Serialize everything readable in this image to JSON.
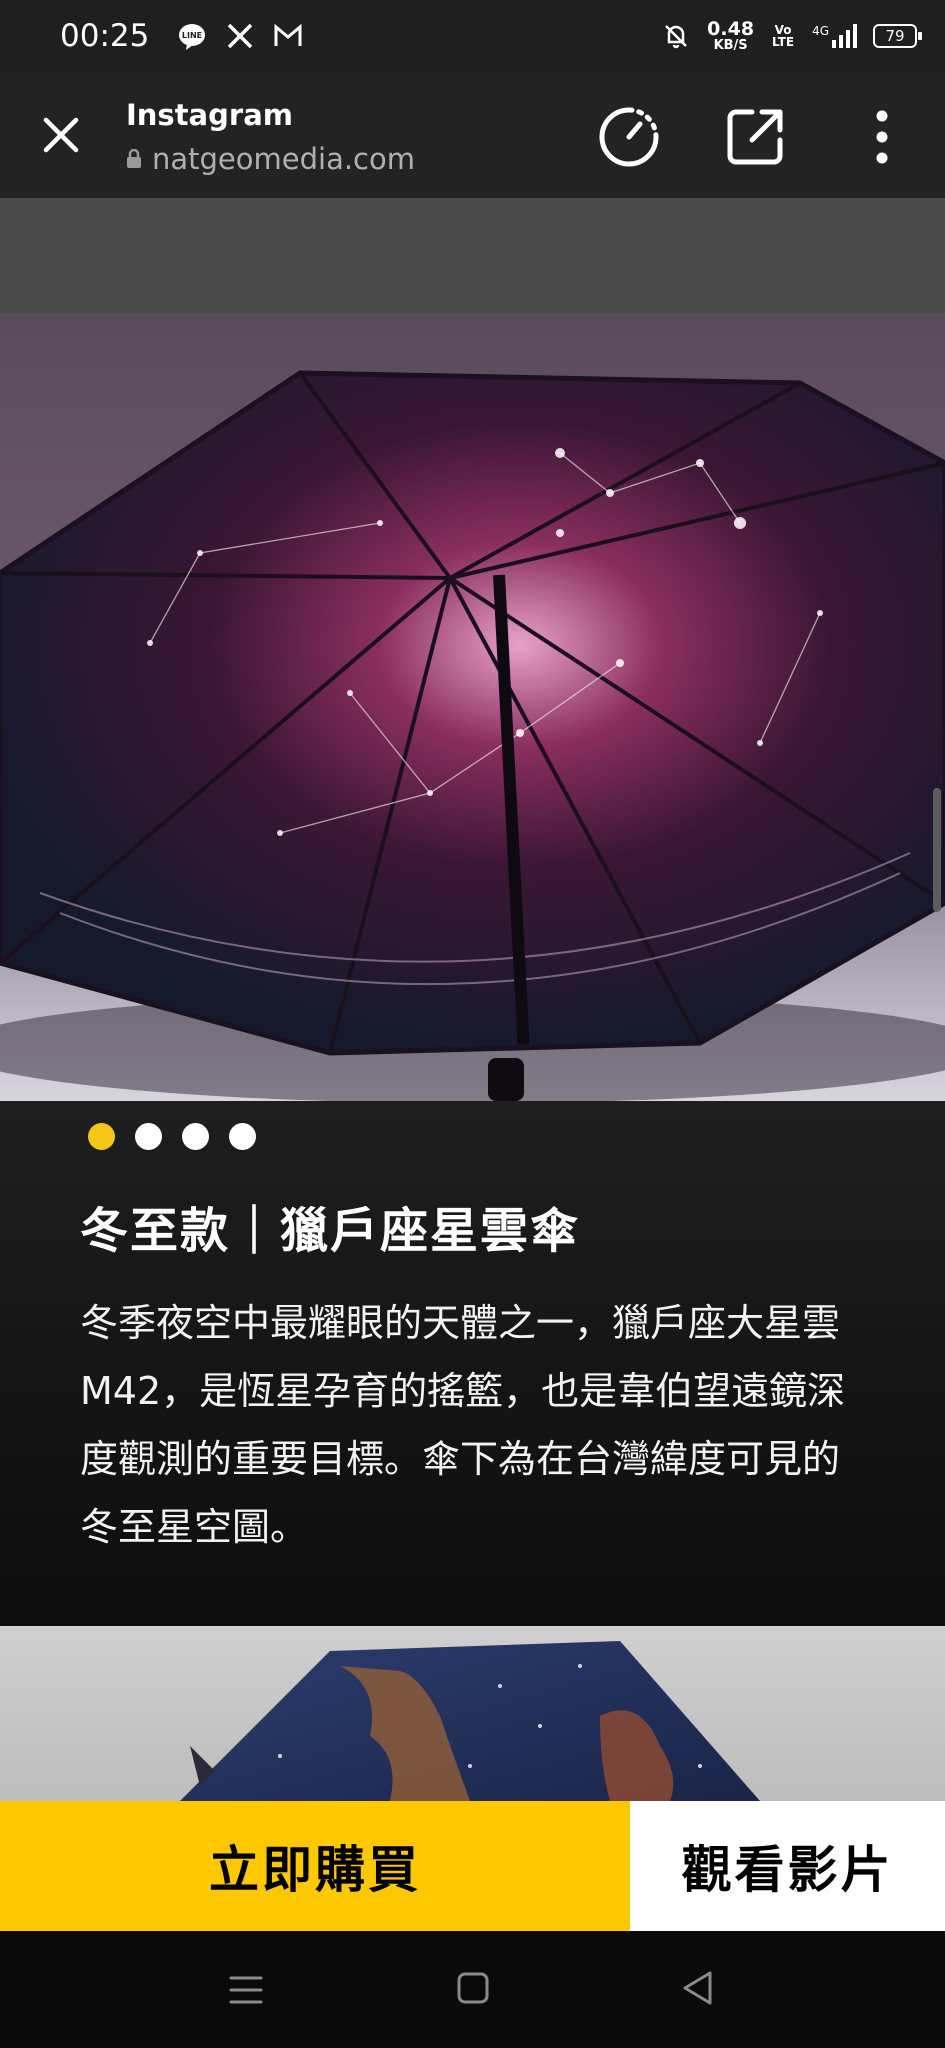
{
  "status_bar": {
    "time": "00:25",
    "icons": [
      "line-icon",
      "x-icon",
      "gmail-icon"
    ],
    "speed_value": "0.48",
    "speed_unit": "KB/S",
    "volte": "Vo LTE",
    "network": "4G",
    "battery": "79"
  },
  "browser": {
    "title": "Instagram",
    "url": "natgeomedia.com"
  },
  "carousel": {
    "count": 4,
    "active_index": 0
  },
  "product": {
    "title": "冬至款｜獵戶座星雲傘",
    "description": "冬季夜空中最耀眼的天體之一，獵戶座大星雲 M42，是恆星孕育的搖籃，也是韋伯望遠鏡深度觀測的重要目標。傘下為在台灣緯度可見的冬至星空圖。"
  },
  "cta": {
    "buy_label": "立即購買",
    "video_label": "觀看影片"
  },
  "colors": {
    "accent_yellow": "#fdc800",
    "dot_active": "#f5c518"
  }
}
